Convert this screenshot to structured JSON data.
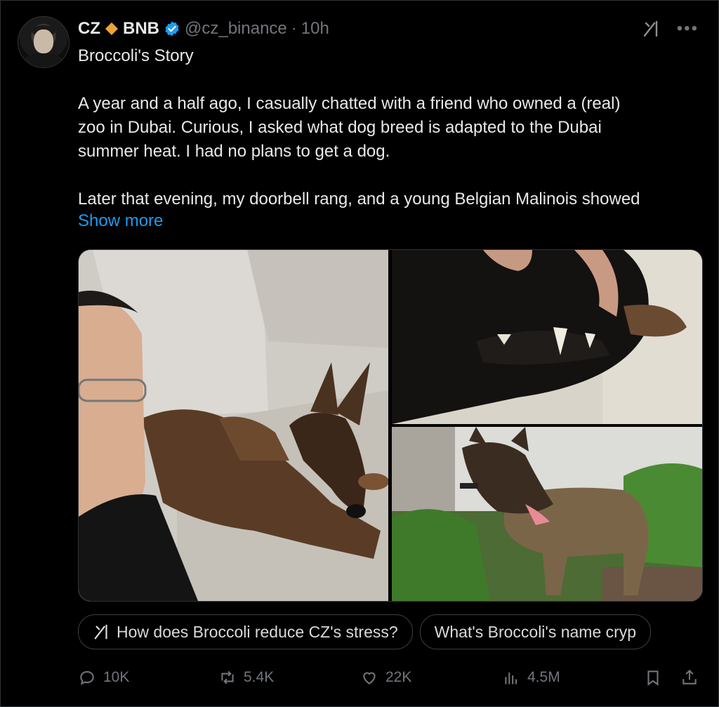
{
  "author": {
    "name": "CZ",
    "affiliation": "BNB",
    "handle": "@cz_binance",
    "separator": "·",
    "time": "10h"
  },
  "tweet": {
    "title": "Broccoli's Story",
    "body": "A year and a half ago, I casually chatted with a friend who owned a (real)\nzoo in Dubai. Curious, I asked what dog breed is adapted to the Dubai\nsummer heat. I had no plans to get a dog.\n\nLater that evening, my doorbell rang, and a young Belgian Malinois showed",
    "show_more": "Show more"
  },
  "grok_prompts": [
    "How does Broccoli reduce CZ's stress?",
    "What's Broccoli's name cryp"
  ],
  "actions": {
    "replies": "10K",
    "reposts": "5.4K",
    "likes": "22K",
    "views": "4.5M"
  },
  "colors": {
    "background": "#000000",
    "text": "#e7e9ea",
    "muted": "#71767b",
    "link": "#1d9bf0",
    "verified": "#1d9bf0",
    "bnb_gold": "#f0a23a"
  },
  "icons": [
    "grok-icon",
    "more-icon",
    "verified-badge-icon",
    "bnb-diamond-icon",
    "reply-icon",
    "repost-icon",
    "like-icon",
    "views-icon",
    "bookmark-icon",
    "share-icon"
  ]
}
